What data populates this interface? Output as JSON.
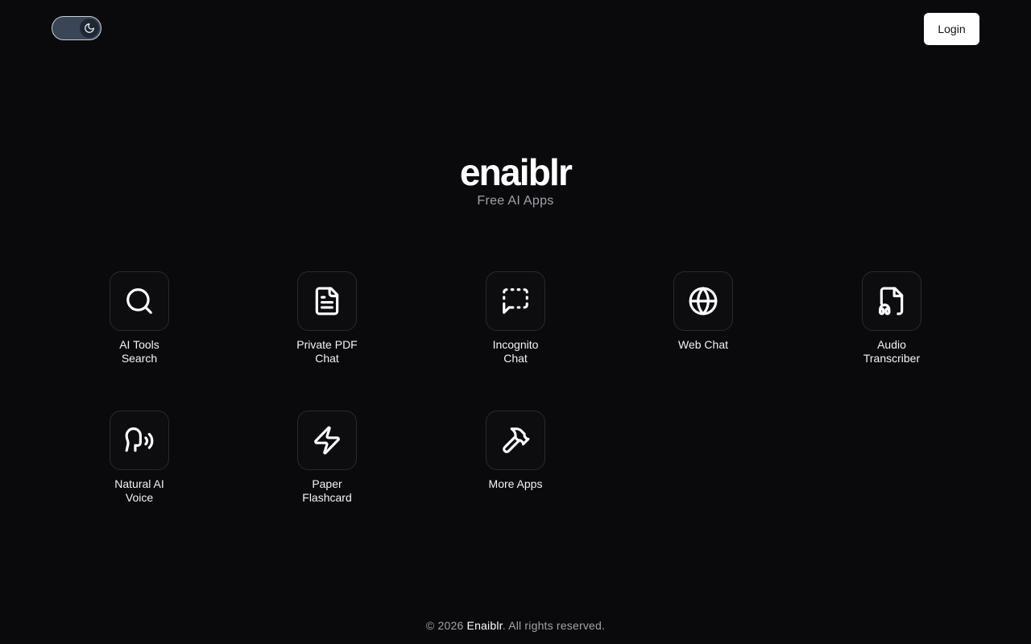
{
  "header": {
    "theme_toggle_icon": "moon-icon",
    "login_label": "Login"
  },
  "hero": {
    "brand": "enaiblr",
    "tagline": "Free AI Apps"
  },
  "apps": [
    {
      "label": "AI Tools Search",
      "line1": "AI Tools",
      "line2": "Search",
      "icon": "search-icon"
    },
    {
      "label": "Private PDF Chat",
      "line1": "Private PDF",
      "line2": "Chat",
      "icon": "document-icon"
    },
    {
      "label": "Incognito Chat",
      "line1": "Incognito",
      "line2": "Chat",
      "icon": "dashed-message-icon"
    },
    {
      "label": "Web Chat",
      "line1": "Web Chat",
      "line2": "",
      "icon": "globe-icon"
    },
    {
      "label": "Audio Transcriber",
      "line1": "Audio",
      "line2": "Transcriber",
      "icon": "file-audio-icon"
    },
    {
      "label": "Natural AI Voice",
      "line1": "Natural AI",
      "line2": "Voice",
      "icon": "speech-icon"
    },
    {
      "label": "Paper Flashcard",
      "line1": "Paper",
      "line2": "Flashcard",
      "icon": "lightning-icon"
    },
    {
      "label": "More Apps",
      "line1": "More Apps",
      "line2": "",
      "icon": "hammer-icon"
    }
  ],
  "footer": {
    "prefix": "© 2026 ",
    "brand": "Enaiblr",
    "suffix": ". All rights reserved."
  },
  "colors": {
    "background": "#0a0a0c",
    "text": "#ffffff",
    "muted": "#a1a1aa",
    "tile_border": "#2a2a2e"
  }
}
